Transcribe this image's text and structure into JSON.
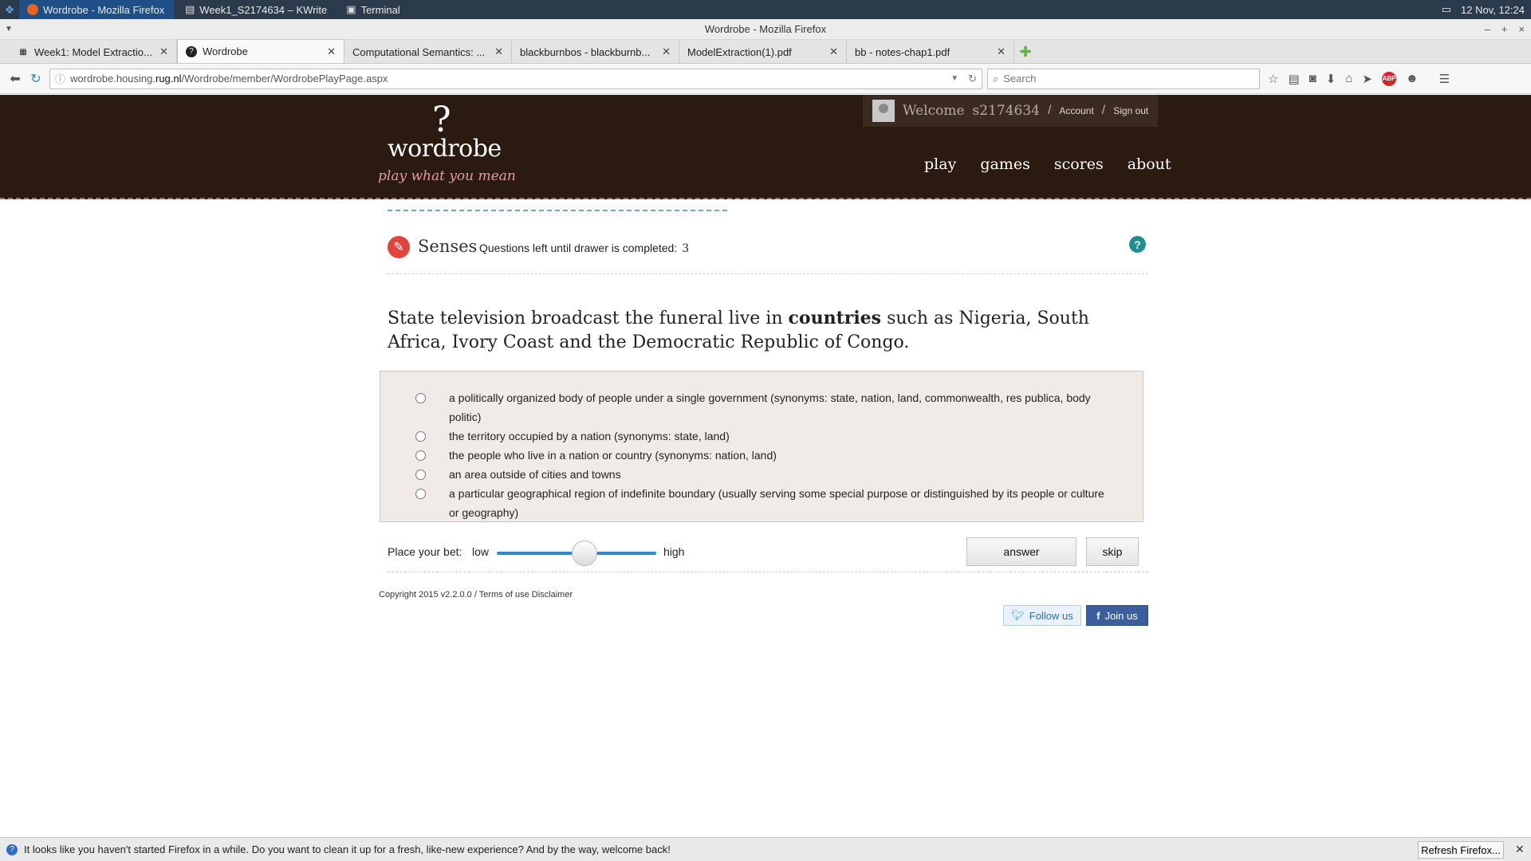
{
  "taskbar": {
    "tasks": [
      {
        "label": "Wordrobe - Mozilla Firefox",
        "active": true
      },
      {
        "label": "Week1_S2174634 – KWrite",
        "active": false
      },
      {
        "label": "Terminal",
        "active": false
      }
    ],
    "clock": "12 Nov, 12:24"
  },
  "window": {
    "title": "Wordrobe - Mozilla Firefox"
  },
  "tabs": [
    {
      "label": "Week1: Model Extractio...",
      "active": false
    },
    {
      "label": "Wordrobe",
      "active": true
    },
    {
      "label": "Computational Semantics: ...",
      "active": false
    },
    {
      "label": "blackburnbos - blackburnb...",
      "active": false
    },
    {
      "label": "ModelExtraction(1).pdf",
      "active": false
    },
    {
      "label": "bb - notes-chap1.pdf",
      "active": false
    }
  ],
  "navbar": {
    "url_prefix": "wordrobe.housing.",
    "url_domain": "rug.nl",
    "url_path": "/Wordrobe/member/WordrobePlayPage.aspx",
    "search_placeholder": "Search"
  },
  "site": {
    "logo_mark": "?",
    "logo_text": "wordrobe",
    "tagline": "play what you mean",
    "welcome": "Welcome",
    "username": "s2174634",
    "account_link": "Account",
    "signout_link": "Sign out",
    "nav": [
      "play",
      "games",
      "scores",
      "about"
    ]
  },
  "game": {
    "section": "Senses",
    "questions_left_label": "Questions left until drawer is completed:",
    "questions_left": "3",
    "sentence_before": "State television broadcast the funeral live in",
    "sentence_target": "countries",
    "sentence_after": "such as Nigeria, South Africa, Ivory Coast and the Democratic Republic of Congo.",
    "options": [
      "a politically organized body of people under a single government (synonyms: state, nation, land, commonwealth, res publica, body politic)",
      "the territory occupied by a nation (synonyms: state, land)",
      "the people who live in a nation or country (synonyms: nation, land)",
      "an area outside of cities and towns",
      "a particular geographical region of indefinite boundary (usually serving some special purpose or distinguished by its people or culture or geography)"
    ],
    "bet_label": "Place your bet:",
    "bet_low": "low",
    "bet_high": "high",
    "bet_level": 0.55,
    "answer_button": "answer",
    "skip_button": "skip"
  },
  "footer": {
    "copyright": "Copyright 2015 v2.2.0.0 / Terms of use Disclaimer",
    "follow_button": "Follow us",
    "join_button": "Join us"
  },
  "notification": {
    "message": "It looks like you haven't started Firefox in a while. Do you want to clean it up for a fresh, like-new experience? And by the way, welcome back!",
    "refresh_button": "Refresh Firefox..."
  }
}
